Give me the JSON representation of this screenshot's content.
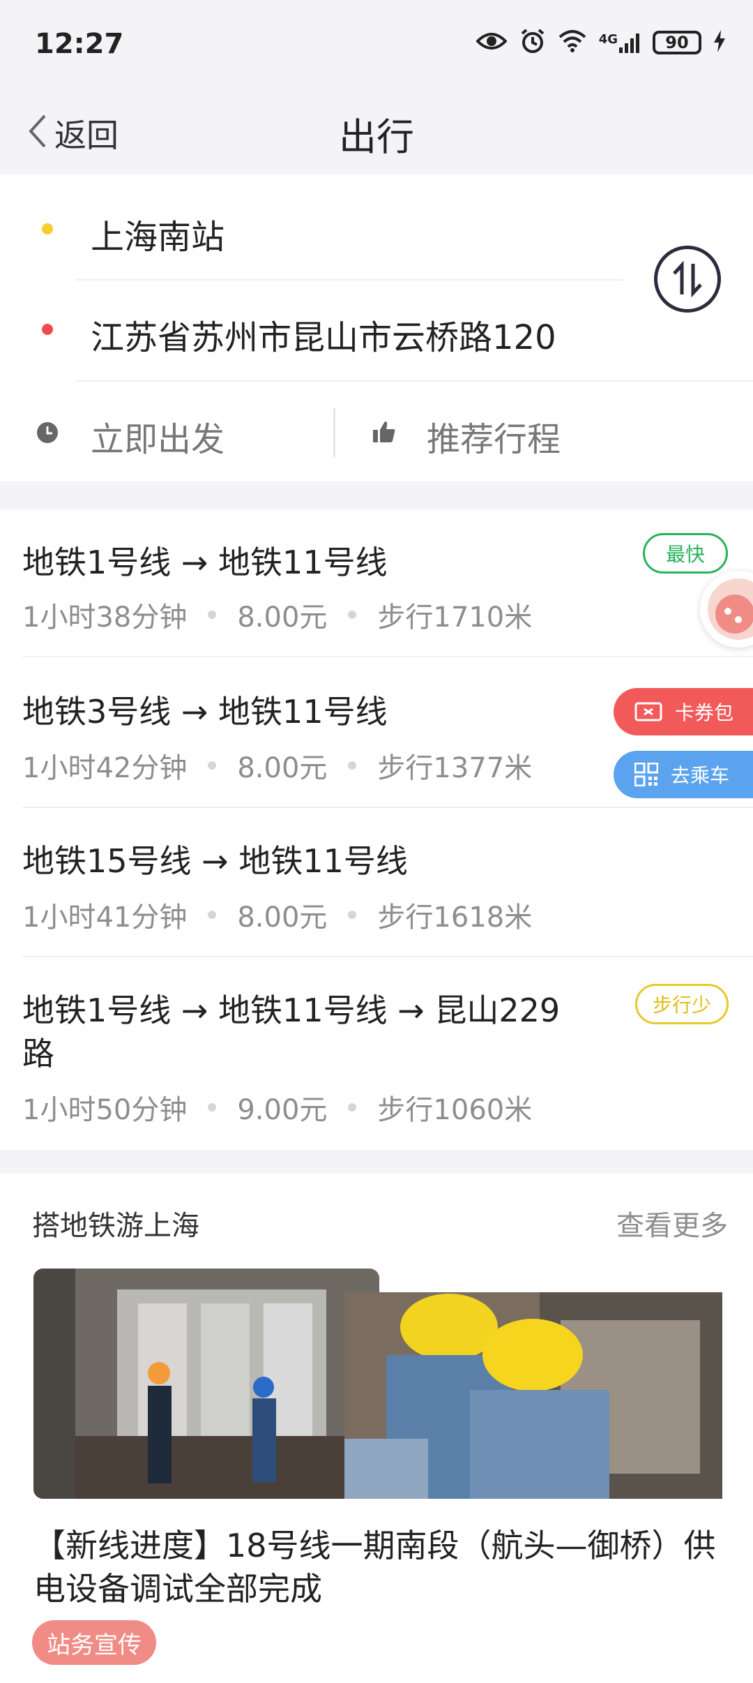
{
  "status_bar": {
    "time": "12:27",
    "battery": "90",
    "network": "4G"
  },
  "header": {
    "back_label": "返回",
    "title": "出行"
  },
  "route_input": {
    "origin": "上海南站",
    "destination": "江苏省苏州市昆山市云桥路120",
    "depart_option": "立即出发",
    "recommend_option": "推荐行程",
    "origin_dot_color": "#f5cf2c",
    "destination_dot_color": "#ef4b4b"
  },
  "routes": [
    {
      "title": "地铁1号线 → 地铁11号线",
      "duration": "1小时38分钟",
      "price": "8.00元",
      "walk": "步行1710米",
      "tag": "最快"
    },
    {
      "title": "地铁3号线 → 地铁11号线",
      "duration": "1小时42分钟",
      "price": "8.00元",
      "walk": "步行1377米",
      "tag": ""
    },
    {
      "title": "地铁15号线 → 地铁11号线",
      "duration": "1小时41分钟",
      "price": "8.00元",
      "walk": "步行1618米",
      "tag": ""
    },
    {
      "title_line1": "地铁1号线 → 地铁11号线 → 昆山229",
      "title_line2": "路",
      "duration": "1小时50分钟",
      "price": "9.00元",
      "walk": "步行1060米",
      "tag": "步行少"
    }
  ],
  "floating_buttons": {
    "coupon": "卡券包",
    "ride": "去乘车"
  },
  "news": {
    "section_title": "搭地铁游上海",
    "more": "查看更多",
    "headline": "【新线进度】18号线一期南段（航头—御桥）供电设备调试全部完成",
    "tag": "站务宣传"
  }
}
